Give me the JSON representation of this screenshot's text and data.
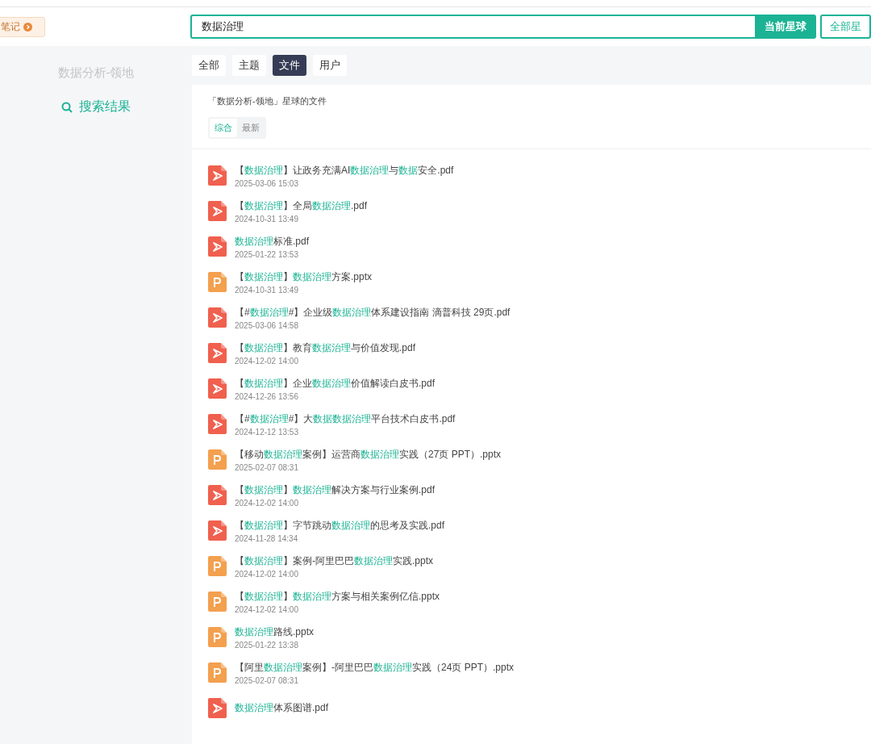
{
  "header": {
    "note_tag": "笔记",
    "search": {
      "value": "数据治理"
    },
    "buttons": [
      {
        "label": "当前星球",
        "selected": true
      },
      {
        "label": "全部星",
        "selected": false
      }
    ]
  },
  "sidebar": {
    "group_name": "数据分析-领地",
    "items": [
      {
        "label": "搜索结果",
        "selected": true
      }
    ]
  },
  "tabs": [
    {
      "label": "全部",
      "selected": false
    },
    {
      "label": "主题",
      "selected": false
    },
    {
      "label": "文件",
      "selected": true
    },
    {
      "label": "用户",
      "selected": false
    }
  ],
  "panel": {
    "title": "「数据分析-领地」星球的文件",
    "sort_tabs": [
      {
        "label": "综合",
        "selected": true
      },
      {
        "label": "最新",
        "selected": false
      }
    ],
    "files": [
      {
        "kind": "pdf",
        "title": [
          {
            "text": "【"
          },
          {
            "text": "数据治理",
            "highlight": true
          },
          {
            "text": "】让政务充满AI"
          },
          {
            "text": "数据治理",
            "highlight": true
          },
          {
            "text": "与"
          },
          {
            "text": "数据",
            "highlight": true
          },
          {
            "text": "安全.pdf"
          }
        ],
        "date": "2025-03-06 15:03"
      },
      {
        "kind": "pdf",
        "title": [
          {
            "text": "【"
          },
          {
            "text": "数据治理",
            "highlight": true
          },
          {
            "text": "】全局"
          },
          {
            "text": "数据治理",
            "highlight": true
          },
          {
            "text": ".pdf"
          }
        ],
        "date": "2024-10-31 13:49"
      },
      {
        "kind": "pdf",
        "title": [
          {
            "text": "数据治理",
            "highlight": true
          },
          {
            "text": "标准.pdf"
          }
        ],
        "date": "2025-01-22 13:53"
      },
      {
        "kind": "pptx",
        "title": [
          {
            "text": "【"
          },
          {
            "text": "数据治理",
            "highlight": true
          },
          {
            "text": "】"
          },
          {
            "text": "数据治理",
            "highlight": true
          },
          {
            "text": "方案.pptx"
          }
        ],
        "date": "2024-10-31 13:49"
      },
      {
        "kind": "pdf",
        "title": [
          {
            "text": "【#"
          },
          {
            "text": "数据治理",
            "highlight": true
          },
          {
            "text": "#】企业级"
          },
          {
            "text": "数据治理",
            "highlight": true
          },
          {
            "text": "体系建设指南 滴普科技 29页.pdf"
          }
        ],
        "date": "2025-03-06 14:58"
      },
      {
        "kind": "pdf",
        "title": [
          {
            "text": "【"
          },
          {
            "text": "数据治理",
            "highlight": true
          },
          {
            "text": "】教育"
          },
          {
            "text": "数据治理",
            "highlight": true
          },
          {
            "text": "与价值发现.pdf"
          }
        ],
        "date": "2024-12-02 14:00"
      },
      {
        "kind": "pdf",
        "title": [
          {
            "text": "【"
          },
          {
            "text": "数据治理",
            "highlight": true
          },
          {
            "text": "】企业"
          },
          {
            "text": "数据治理",
            "highlight": true
          },
          {
            "text": "价值解读白皮书.pdf"
          }
        ],
        "date": "2024-12-26 13:56"
      },
      {
        "kind": "pdf",
        "title": [
          {
            "text": "【#"
          },
          {
            "text": "数据治理",
            "highlight": true
          },
          {
            "text": "#】大"
          },
          {
            "text": "数据数据治理",
            "highlight": true
          },
          {
            "text": "平台技术白皮书.pdf"
          }
        ],
        "date": "2024-12-12 13:53"
      },
      {
        "kind": "pptx",
        "title": [
          {
            "text": "【移动"
          },
          {
            "text": "数据治理",
            "highlight": true
          },
          {
            "text": "案例】运营商"
          },
          {
            "text": "数据治理",
            "highlight": true
          },
          {
            "text": "实践（27页 PPT）.pptx"
          }
        ],
        "date": "2025-02-07 08:31"
      },
      {
        "kind": "pdf",
        "title": [
          {
            "text": "【"
          },
          {
            "text": "数据治理",
            "highlight": true
          },
          {
            "text": "】"
          },
          {
            "text": "数据治理",
            "highlight": true
          },
          {
            "text": "解决方案与行业案例.pdf"
          }
        ],
        "date": "2024-12-02 14:00"
      },
      {
        "kind": "pdf",
        "title": [
          {
            "text": "【"
          },
          {
            "text": "数据治理",
            "highlight": true
          },
          {
            "text": "】字节跳动"
          },
          {
            "text": "数据治理",
            "highlight": true
          },
          {
            "text": "的思考及实践.pdf"
          }
        ],
        "date": "2024-11-28 14:34"
      },
      {
        "kind": "pptx",
        "title": [
          {
            "text": "【"
          },
          {
            "text": "数据治理",
            "highlight": true
          },
          {
            "text": "】案例-阿里巴巴"
          },
          {
            "text": "数据治理",
            "highlight": true
          },
          {
            "text": "实践.pptx"
          }
        ],
        "date": "2024-12-02 14:00"
      },
      {
        "kind": "pptx",
        "title": [
          {
            "text": "【"
          },
          {
            "text": "数据治理",
            "highlight": true
          },
          {
            "text": "】"
          },
          {
            "text": "数据治理",
            "highlight": true
          },
          {
            "text": "方案与相关案例亿信.pptx"
          }
        ],
        "date": "2024-12-02 14:00"
      },
      {
        "kind": "pptx",
        "title": [
          {
            "text": "数据治理",
            "highlight": true
          },
          {
            "text": "路线.pptx"
          }
        ],
        "date": "2025-01-22 13:38"
      },
      {
        "kind": "pptx",
        "title": [
          {
            "text": "【阿里"
          },
          {
            "text": "数据治理",
            "highlight": true
          },
          {
            "text": "案例】-阿里巴巴"
          },
          {
            "text": "数据治理",
            "highlight": true
          },
          {
            "text": "实践（24页 PPT）.pptx"
          }
        ],
        "date": "2025-02-07 08:31"
      },
      {
        "kind": "pdf",
        "title": [
          {
            "text": "数据治理",
            "highlight": true
          },
          {
            "text": "体系图谱.pdf"
          }
        ]
      }
    ]
  }
}
